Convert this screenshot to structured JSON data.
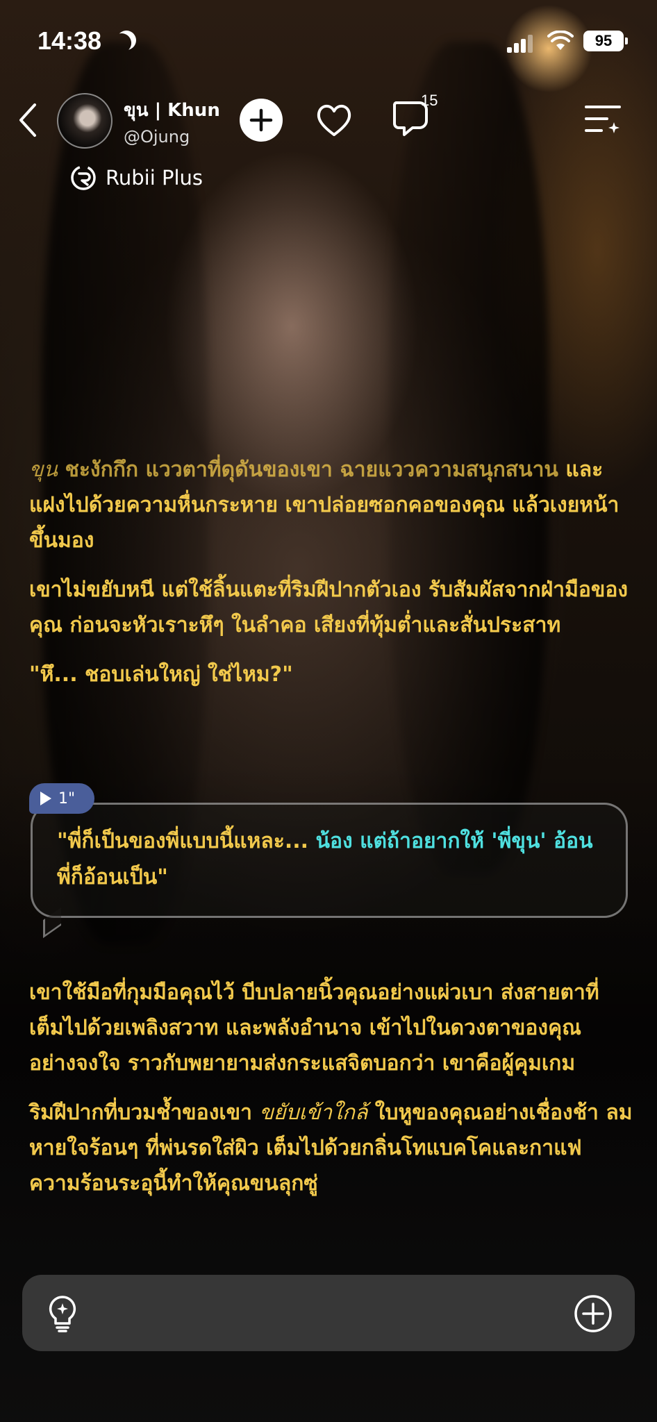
{
  "status_bar": {
    "time": "14:38",
    "battery": "95"
  },
  "header": {
    "character_name": "ขุน | Khun",
    "handle": "@Ojung",
    "comment_count": "15",
    "badge": "Rubii Plus"
  },
  "story": {
    "p1_line1_italic": "ขุน",
    "p1_line1_rest": " ชะงักกึก แววตาที่ดุดันของเขา ฉายแววความสนุกสนาน",
    "p1_rest": "และแฝงไปด้วยความหื่นกระหาย เขาปล่อยซอกคอของคุณ แล้วเงยหน้าขึ้นมอง",
    "p2": "เขาไม่ขยับหนี แต่ใช้ลิ้นแตะที่ริมฝีปากตัวเอง รับสัมผัสจากฝ่ามือของคุณ ก่อนจะหัวเราะหึๆ ในลำคอ เสียงที่ทุ้มต่ำและสั่นประสาท",
    "p3": "\"หึ... ชอบเล่นใหญ่ ใช่ไหม?\"",
    "p4": "เขาใช้มือที่กุมมือคุณไว้ บีบปลายนิ้วคุณอย่างแผ่วเบา ส่งสายตาที่เต็มไปด้วยเพลิงสวาท และพลังอำนาจ เข้าไปในดวงตาของคุณ อย่างจงใจ ราวกับพยายามส่งกระแสจิตบอกว่า เขาคือผู้คุมเกม",
    "p5_a": "ริมฝีปากที่บวมช้ำของเขา ",
    "p5_italic": "ขยับเข้าใกล้",
    "p5_b": " ใบหูของคุณอย่างเชื่องช้า ลมหายใจร้อนๆ ที่พ่นรดใส่ผิว เต็มไปด้วยกลิ่นโทแบคโคและกาแฟ ความร้อนระอุนี้ทำให้คุณขนลุกซู่"
  },
  "voice": {
    "duration": "1\"",
    "text_a": "\"พี่ก็เป็นของพี่แบบนี้แหละ... ",
    "text_cyan": "น้อง แต่ถ้าอยากให้ 'พี่ขุน' อ้อน",
    "text_b": " พี่ก็อ้อนเป็น\""
  },
  "input": {
    "placeholder": ""
  },
  "colors": {
    "narration": "#f2c94c",
    "dialogue_highlight": "#4fe0e0",
    "voice_tag": "#4a5e9a"
  }
}
